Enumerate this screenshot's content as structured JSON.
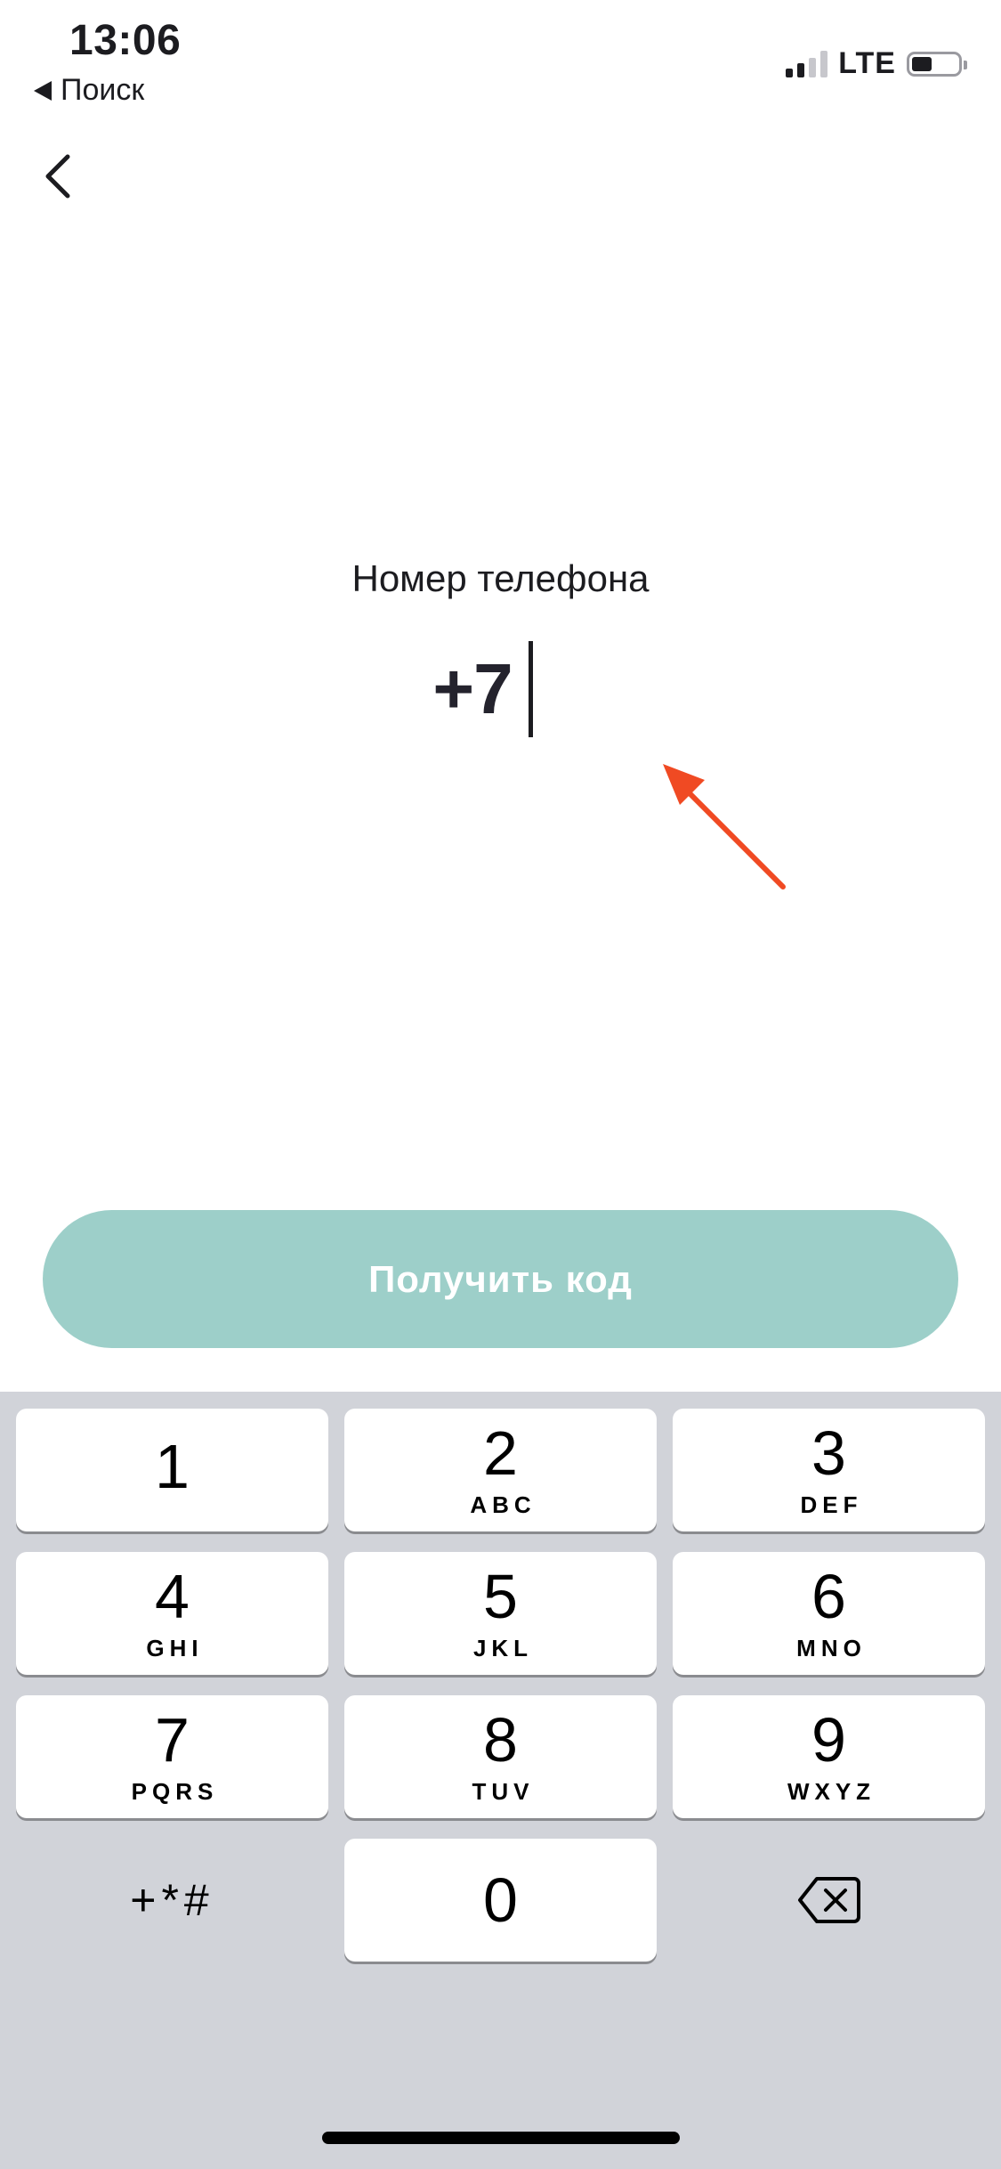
{
  "status_bar": {
    "time": "13:06",
    "back_app": "Поиск",
    "network": "LTE",
    "signal_bars": 2,
    "signal_bars_total": 4,
    "battery_level": 0.3
  },
  "nav": {
    "back_icon": "chevron-left-icon"
  },
  "phone": {
    "label": "Номер телефона",
    "value": "+7"
  },
  "annotation": {
    "icon": "red-arrow-icon",
    "color": "#f04a23"
  },
  "button": {
    "label": "Получить код",
    "color": "#9dcfc9"
  },
  "keypad": {
    "keys": [
      {
        "digit": "1",
        "letters": ""
      },
      {
        "digit": "2",
        "letters": "ABC"
      },
      {
        "digit": "3",
        "letters": "DEF"
      },
      {
        "digit": "4",
        "letters": "GHI"
      },
      {
        "digit": "5",
        "letters": "JKL"
      },
      {
        "digit": "6",
        "letters": "MNO"
      },
      {
        "digit": "7",
        "letters": "PQRS"
      },
      {
        "digit": "8",
        "letters": "TUV"
      },
      {
        "digit": "9",
        "letters": "WXYZ"
      },
      {
        "digit": "0",
        "letters": ""
      }
    ],
    "symbols": "+*#",
    "delete_icon": "backspace-icon"
  }
}
